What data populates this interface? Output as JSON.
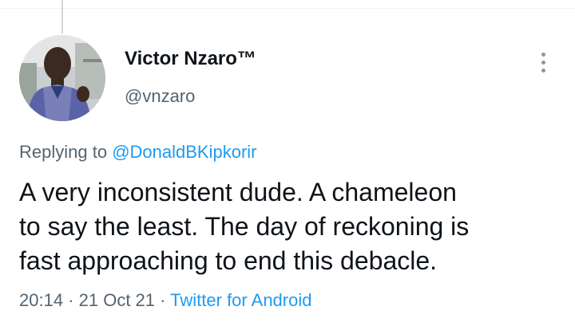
{
  "colors": {
    "text_primary": "#0f1419",
    "text_secondary": "#536471",
    "accent": "#1d9bf0",
    "divider": "#cfd9de"
  },
  "author": {
    "display_name": "Victor Nzaro™",
    "handle": "@vnzaro",
    "avatar_icon": "profile-photo"
  },
  "more_icon": "vertical-ellipsis-icon",
  "reply": {
    "prefix": "Replying to ",
    "mention": "@DonaldBKipkorir"
  },
  "tweet": {
    "lines": [
      "A very inconsistent dude. A chameleon",
      "to say the least. The day of reckoning is",
      "fast approaching to end this debacle."
    ]
  },
  "meta": {
    "time": "20:14",
    "separator1": " · ",
    "date": "21 Oct 21",
    "separator2": " · ",
    "source": "Twitter for Android"
  }
}
